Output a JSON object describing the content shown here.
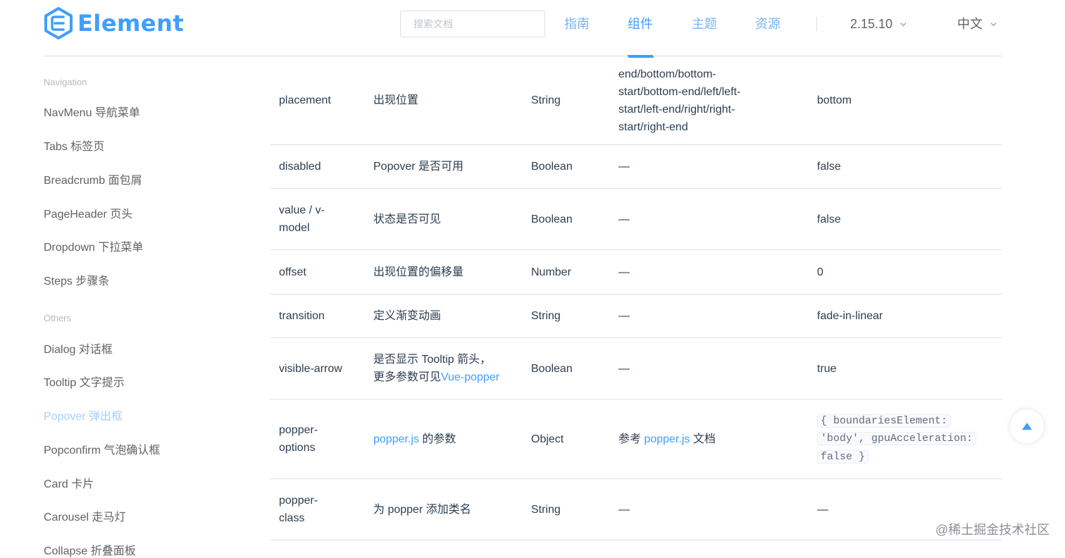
{
  "header": {
    "logo_text": "Element",
    "search_placeholder": "搜索文档",
    "nav": [
      "指南",
      "组件",
      "主题",
      "资源"
    ],
    "active_nav": "组件",
    "version": "2.15.10",
    "language": "中文"
  },
  "sidebar": {
    "groups": [
      {
        "title": "Navigation",
        "items": [
          "NavMenu 导航菜单",
          "Tabs 标签页",
          "Breadcrumb 面包屑",
          "PageHeader 页头",
          "Dropdown 下拉菜单",
          "Steps 步骤条"
        ]
      },
      {
        "title": "Others",
        "items": [
          "Dialog 对话框",
          "Tooltip 文字提示",
          "Popover 弹出框",
          "Popconfirm 气泡确认框",
          "Card 卡片",
          "Carousel 走马灯",
          "Collapse 折叠面板"
        ]
      }
    ],
    "active_item": "Popover 弹出框"
  },
  "table": {
    "rows": [
      {
        "param": "placement",
        "desc": "出现位置",
        "type": "String",
        "accepted": [
          "end/bottom/bottom-",
          "start/bottom-end/left/left-",
          "start/left-end/right/right-",
          "start/right-end"
        ],
        "default": "bottom"
      },
      {
        "param": "disabled",
        "desc": "Popover 是否可用",
        "type": "Boolean",
        "accepted": "—",
        "default": "false"
      },
      {
        "param": "value / v-model",
        "desc": "状态是否可见",
        "type": "Boolean",
        "accepted": "—",
        "default": "false"
      },
      {
        "param": "offset",
        "desc": "出现位置的偏移量",
        "type": "Number",
        "accepted": "—",
        "default": "0"
      },
      {
        "param": "transition",
        "desc": "定义渐变动画",
        "type": "String",
        "accepted": "—",
        "default": "fade-in-linear"
      },
      {
        "param": "visible-arrow",
        "desc_line1": "是否显示 Tooltip 箭头，",
        "desc_prefix": "更多参数可见",
        "desc_link": "Vue-popper",
        "type": "Boolean",
        "accepted": "—",
        "default": "true"
      },
      {
        "param": "popper-options",
        "desc_link": "popper.js",
        "desc_suffix": " 的参数",
        "type": "Object",
        "accepted_prefix": "参考 ",
        "accepted_link": "popper.js",
        "accepted_suffix": " 文档",
        "default_code": [
          "{ boundariesElement:",
          "'body', gpuAcceleration:",
          "false }"
        ]
      },
      {
        "param": "popper-class",
        "desc": "为 popper 添加类名",
        "type": "String",
        "accepted": "—",
        "default": "—"
      }
    ]
  },
  "watermark": "@稀土掘金技术社区"
}
